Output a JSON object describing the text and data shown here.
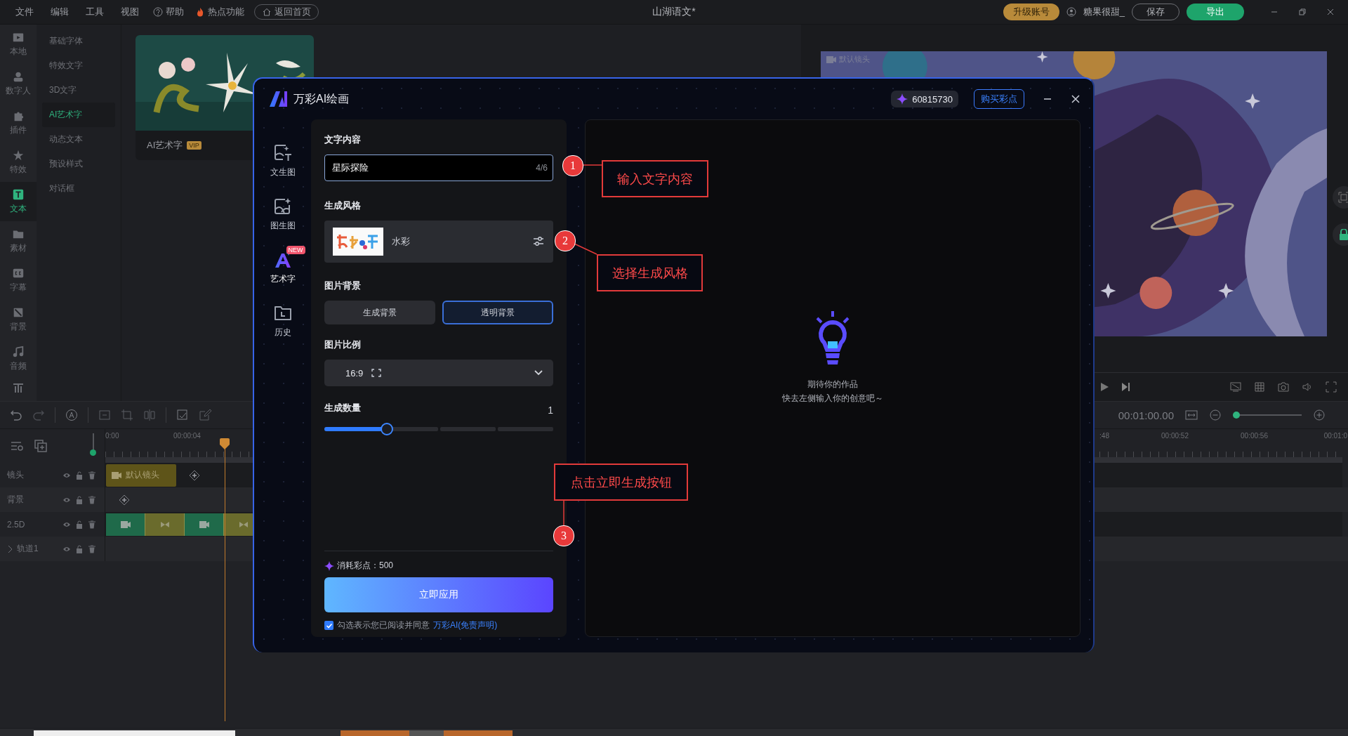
{
  "menu": [
    {
      "label": "文件"
    },
    {
      "label": "编辑"
    },
    {
      "label": "工具"
    },
    {
      "label": "视图"
    }
  ],
  "links": [
    {
      "kind": "help",
      "label": "帮助"
    },
    {
      "kind": "hot",
      "label": "热点功能"
    },
    {
      "kind": "home",
      "label": "返回首页"
    }
  ],
  "document_title": "山湖语文*",
  "account": {
    "upgrade": "升级账号",
    "user": "糖果很甜_",
    "save": "保存",
    "export": "导出"
  },
  "rail": [
    {
      "kind": "local",
      "label": "本地",
      "selected": false
    },
    {
      "kind": "person",
      "label": "数字人",
      "selected": false
    },
    {
      "kind": "plugin",
      "label": "插件",
      "selected": false
    },
    {
      "kind": "effect",
      "label": "特效",
      "selected": false
    },
    {
      "kind": "text",
      "label": "文本",
      "selected": true
    },
    {
      "kind": "folder",
      "label": "素材",
      "selected": false
    },
    {
      "kind": "caption",
      "label": "字幕",
      "selected": false
    },
    {
      "kind": "background",
      "label": "背景",
      "selected": false
    },
    {
      "kind": "audio",
      "label": "音频",
      "selected": false
    }
  ],
  "categories": [
    {
      "label": "基础字体",
      "selected": false
    },
    {
      "label": "特效文字",
      "selected": false
    },
    {
      "label": "3D文字",
      "selected": false
    },
    {
      "label": "AI艺术字",
      "selected": true
    },
    {
      "label": "动态文本",
      "selected": false
    },
    {
      "label": "预设样式",
      "selected": false
    },
    {
      "label": "对话框",
      "selected": false
    }
  ],
  "template_card": {
    "label": "AI艺术字",
    "badge": "VIP"
  },
  "preview": {
    "clip_label": "默认镜头"
  },
  "timeline": {
    "timecode": "00:01:00.00",
    "zoom_slider": {
      "level": 0
    },
    "track_height_slider": {
      "level": 0
    },
    "ruler_left": [
      "0:00",
      "00:00:04"
    ],
    "ruler_right": [
      ":48",
      "00:00:52",
      "00:00:56",
      "00:01:0"
    ],
    "tracks": [
      {
        "name": "镜头",
        "kind": "clip",
        "clip": "默认镜头"
      },
      {
        "name": "背景",
        "kind": "add"
      },
      {
        "name": "2.5D",
        "kind": "segments"
      },
      {
        "name": "轨道1",
        "kind": "group"
      }
    ]
  },
  "dialog": {
    "title": "万彩AI绘画",
    "points": "60815730",
    "buy": "购买彩点",
    "nav": [
      {
        "kind": "text2img",
        "label": "文生图",
        "selected": false
      },
      {
        "kind": "img2img",
        "label": "图生图",
        "selected": false
      },
      {
        "kind": "art",
        "label": "艺术字",
        "selected": true,
        "badge": "NEW"
      },
      {
        "kind": "history",
        "label": "历史",
        "selected": false
      }
    ],
    "form": {
      "text_label": "文字内容",
      "text_value": "星际探险",
      "text_count": "4/6",
      "style_label": "生成风格",
      "style_name": "水彩",
      "background_label": "图片背景",
      "background_options": [
        {
          "label": "生成背景",
          "selected": false
        },
        {
          "label": "透明背景",
          "selected": true
        }
      ],
      "ratio_label": "图片比例",
      "ratio_value": "16:9",
      "count_label": "生成数量",
      "count_value": "1",
      "count_slider": {
        "level": 0.27
      },
      "cost": "消耗彩点：500",
      "apply": "立即应用",
      "agree": {
        "checked": true,
        "text": "勾选表示您已阅读并同意",
        "link": "万彩AI(免责声明)"
      }
    },
    "result": {
      "line1": "期待你的作品",
      "line2": "快去左侧输入你的创意吧～"
    }
  },
  "annotations": [
    {
      "number": "1",
      "text": "输入文字内容"
    },
    {
      "number": "2",
      "text": "选择生成风格"
    },
    {
      "number": "3",
      "text": "点击立即生成按钮"
    }
  ]
}
